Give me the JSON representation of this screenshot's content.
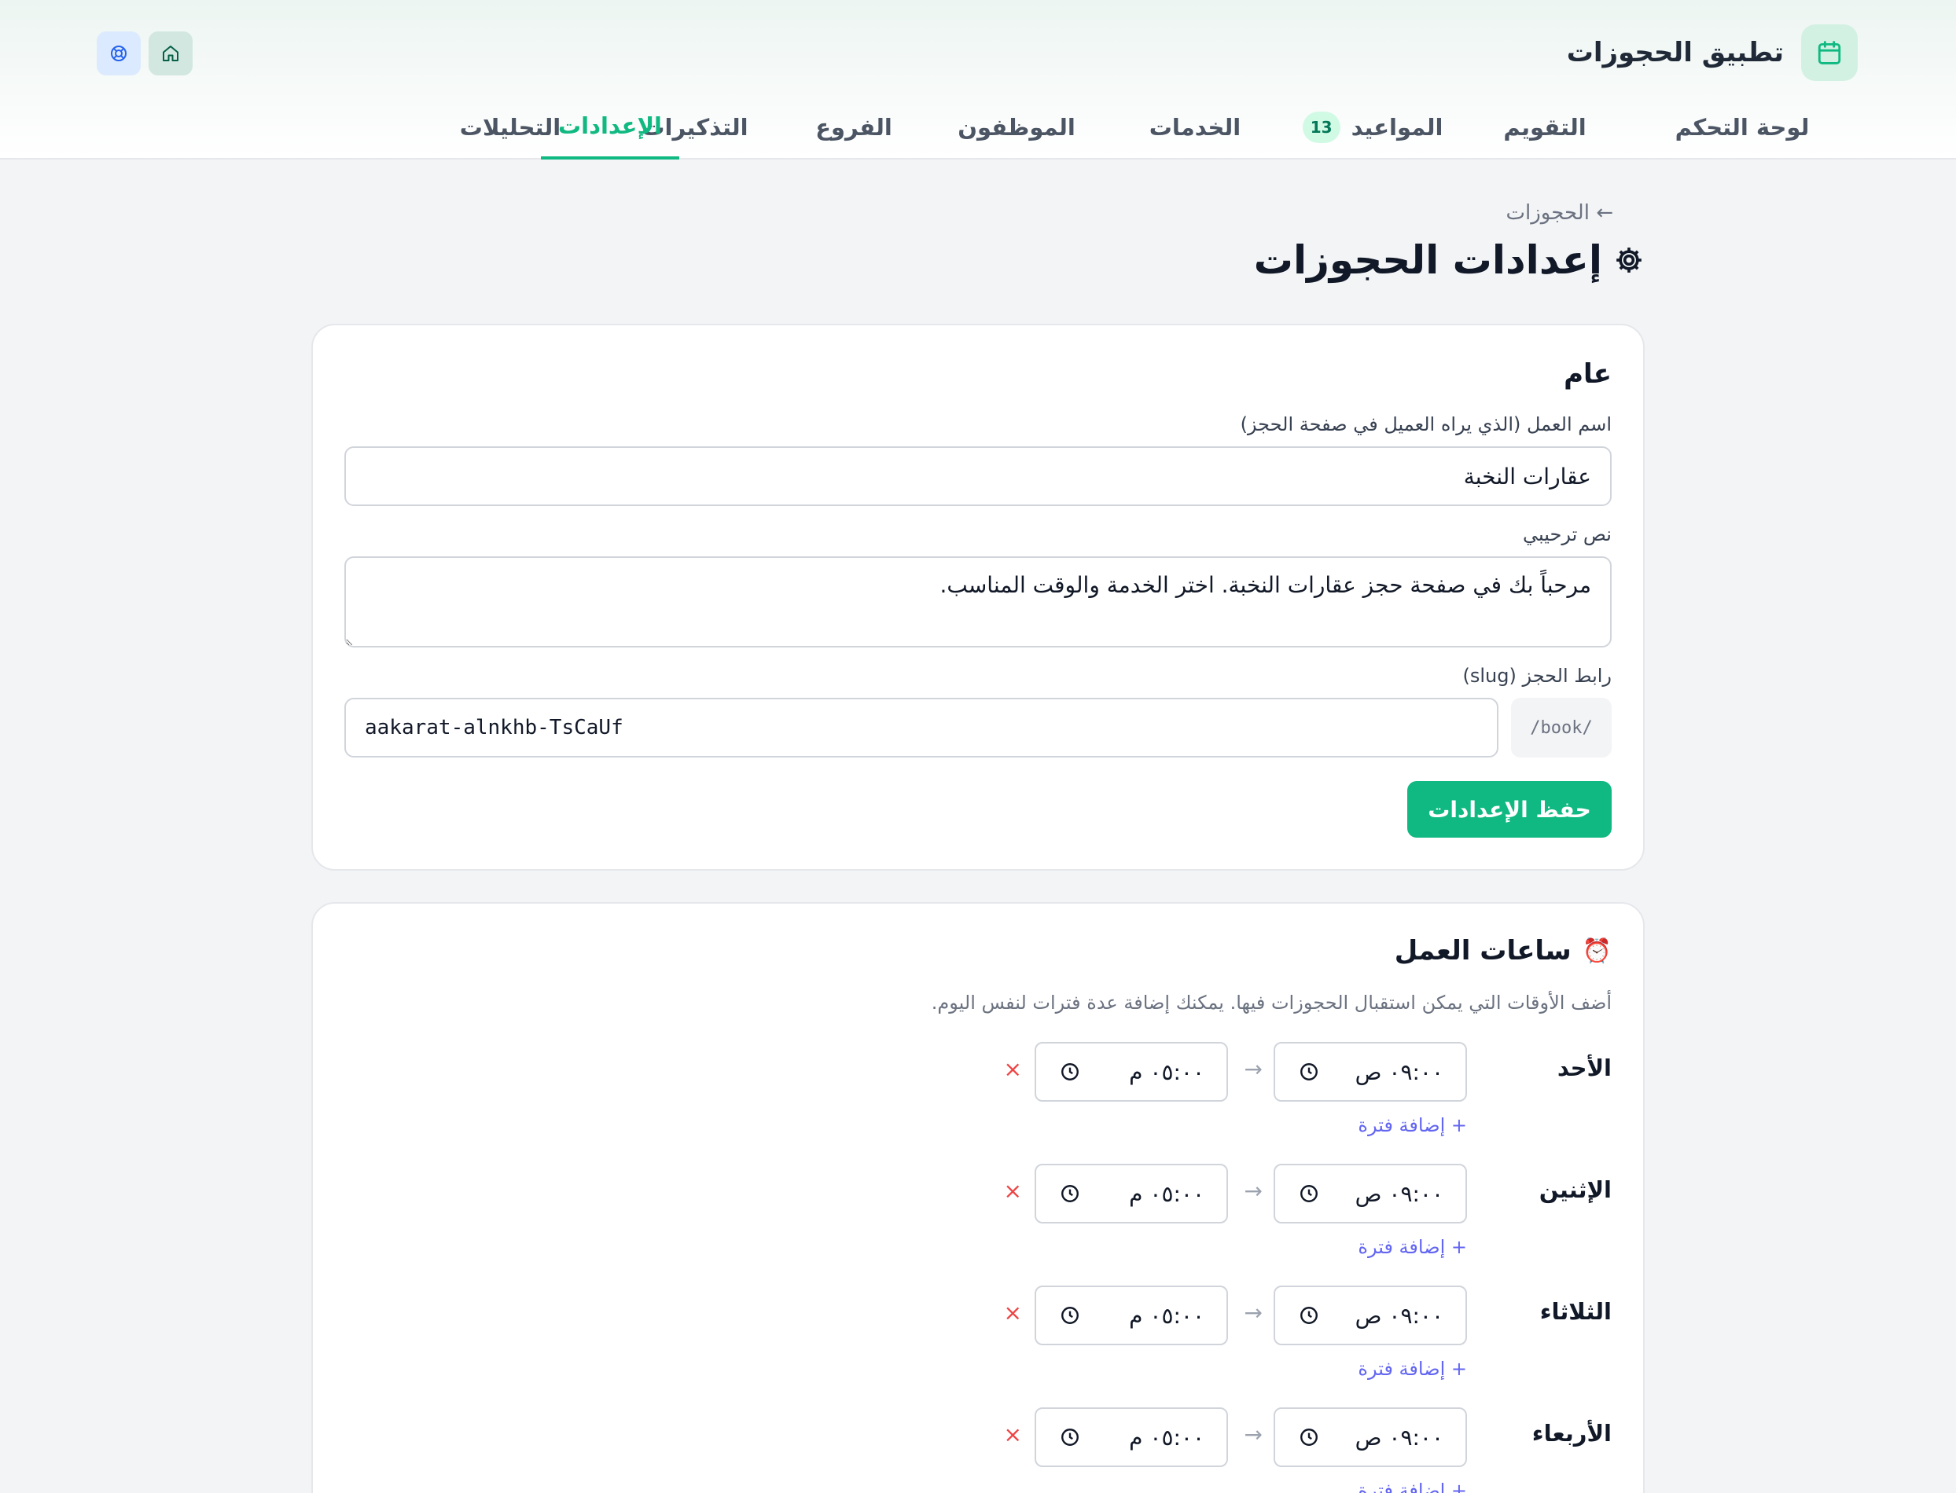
{
  "app": {
    "title": "تطبيق الحجوزات",
    "brand_color": "#10b981"
  },
  "nav": {
    "items": [
      {
        "label": "لوحة التحكم"
      },
      {
        "label": "التقويم"
      },
      {
        "label": "المواعيد",
        "badge": "13"
      },
      {
        "label": "الخدمات"
      },
      {
        "label": "الموظفون"
      },
      {
        "label": "الفروع"
      },
      {
        "label": "التذكيرات"
      },
      {
        "label": "التحليلات"
      },
      {
        "label": "الإعدادات",
        "active": true
      }
    ]
  },
  "breadcrumb": "← الحجوزات",
  "page_title": "إعدادات الحجوزات",
  "page_title_icon": "gear-icon",
  "general": {
    "title": "عام",
    "business_name_label": "اسم العمل (الذي يراه العميل في صفحة الحجز)",
    "business_name_value": "عقارات النخبة",
    "welcome_label": "نص ترحيبي",
    "welcome_value": "مرحباً بك في صفحة حجز عقارات النخبة. اختر الخدمة والوقت المناسب.",
    "slug_label": "رابط الحجز (slug)",
    "slug_prefix": "/book/",
    "slug_value": "aakarat-alnkhb-TsCaUf",
    "save_label": "حفظ الإعدادات"
  },
  "hours": {
    "title": "ساعات العمل",
    "title_icon": "alarm-clock-icon",
    "hint": "أضف الأوقات التي يمكن استقبال الحجوزات فيها. يمكنك إضافة عدة فترات لنفس اليوم.",
    "add_period_label": "+ إضافة فترة",
    "days": [
      {
        "name": "الأحد",
        "start": "٠٩:٠٠ ص",
        "end": "٠٥:٠٠ م"
      },
      {
        "name": "الإثنين",
        "start": "٠٩:٠٠ ص",
        "end": "٠٥:٠٠ م"
      },
      {
        "name": "الثلاثاء",
        "start": "٠٩:٠٠ ص",
        "end": "٠٥:٠٠ م"
      },
      {
        "name": "الأربعاء",
        "start": "٠٩:٠٠ ص",
        "end": "٠٥:٠٠ م"
      }
    ]
  }
}
